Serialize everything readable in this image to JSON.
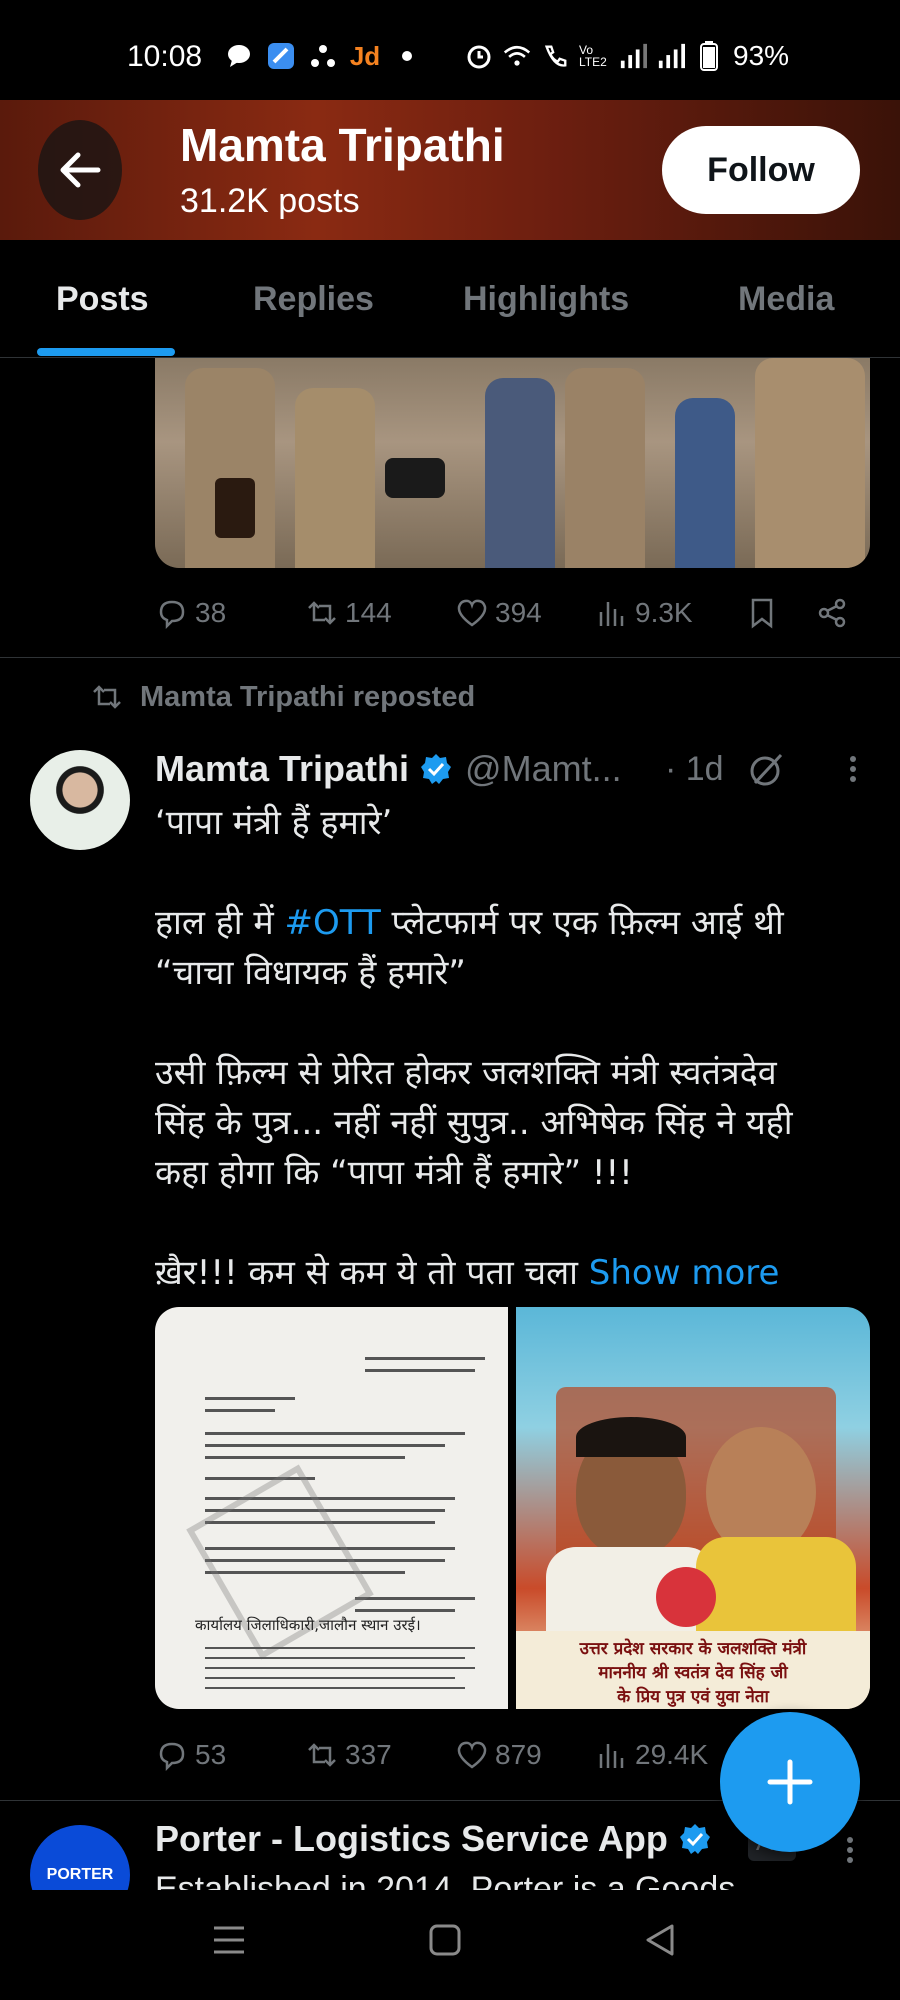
{
  "status_bar": {
    "time": "10:08",
    "battery": "93%",
    "network_label": "Vo LTE2"
  },
  "header": {
    "name": "Mamta Tripathi",
    "posts_count": "31.2K posts",
    "follow_label": "Follow",
    "back_icon": "arrow-left-icon"
  },
  "tabs": [
    "Posts",
    "Replies",
    "Highlights",
    "Media"
  ],
  "prev_post": {
    "replies": "38",
    "reposts": "144",
    "likes": "394",
    "views": "9.3K"
  },
  "repost_note": "Mamta Tripathi reposted",
  "post": {
    "author": "Mamta Tripathi",
    "handle": "@Mamt...",
    "age": "· 1d",
    "line1": "‘पापा मंत्री हैं हमारे’",
    "line2a": "हाल ही में ",
    "hashtag": "#OTT",
    "line2b": " प्लेटफार्म पर एक फ़िल्म आई थी",
    "line3": "“चाचा विधायक हैं हमारे”",
    "line4": "उसी फ़िल्म से प्रेरित होकर जलशक्ति मंत्री स्वतंत्रदेव",
    "line5": "सिंह के पुत्र... नहीं नहीं सुपुत्र.. अभिषेक सिंह ने यही",
    "line6": "कहा होगा कि “पापा मंत्री हैं हमारे” !!!",
    "line7": "ख़ैर!!! कम से कम ये तो पता चला ",
    "show_more": "Show more",
    "photo_caption_1": "उत्तर प्रदेश सरकार के जलशक्ति मंत्री",
    "photo_caption_2": "माननीय श्री स्वतंत्र देव सिंह जी",
    "photo_caption_3": "के प्रिय पुत्र एवं युवा नेता",
    "doc_footer": "कार्यालय जिलाधिकारी,जालौन स्थान उरई।",
    "replies": "53",
    "reposts": "337",
    "likes": "879",
    "views": "29.4K"
  },
  "ad": {
    "avatar_text": "PORTER",
    "name": "Porter - Logistics Service App",
    "badge": "Ad",
    "text": "Established in 2014, Porter is a Goods"
  },
  "colors": {
    "accent": "#1d9bf0",
    "muted": "#71767b",
    "background": "#000000"
  }
}
